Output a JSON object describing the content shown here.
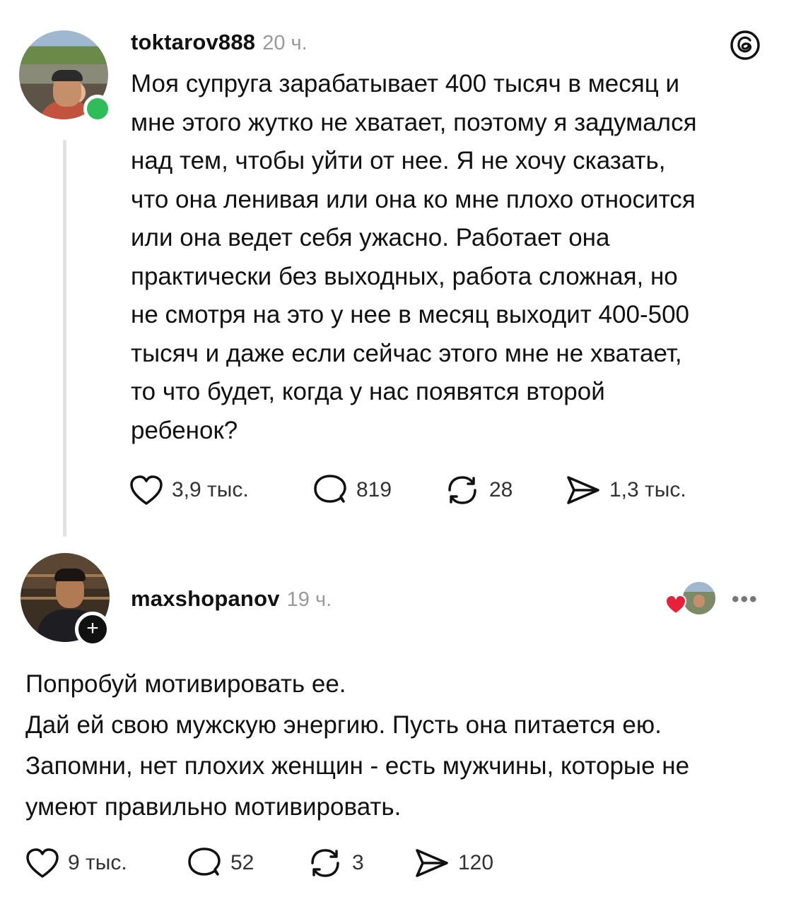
{
  "post": {
    "username": "toktarov888",
    "time": "20 ч.",
    "lines": [
      "Моя супруга зарабатывает 400 тысяч в месяц и",
      "мне этого жутко не хватает, поэтому я задумался",
      "над тем, чтобы уйти от нее. Я не хочу сказать,",
      "что она ленивая или она ко мне плохо относится",
      "или она ведет себя ужасно. Работает она",
      "практически без выходных, работа сложная, но",
      "не смотря на это у нее в месяц выходит 400-500",
      "тысяч и даже если сейчас этого мне не хватает,",
      "то что будет, когда у нас появятся второй",
      "ребенок?"
    ],
    "likes": "3,9 тыс.",
    "comments": "819",
    "reposts": "28",
    "shares": "1,3 тыс.",
    "online_color": "#2ebd59"
  },
  "reply": {
    "username": "maxshopanov",
    "time": "19 ч.",
    "lines": [
      "Попробуй мотивировать ее.",
      "Дай ей свою мужскую энергию. Пусть она питается ею.",
      "Запомни, нет плохих женщин - есть мужчины, которые не",
      "умеют правильно мотивировать."
    ],
    "likes": "9 тыс.",
    "comments": "52",
    "reposts": "3",
    "shares": "120",
    "follow_label": "+",
    "liked_by_author_heart_color": "#e8213a"
  },
  "icons": {
    "app_logo": "threads-logo-icon",
    "like": "heart-icon",
    "comment": "comment-bubble-icon",
    "repost": "repost-icon",
    "share": "send-icon",
    "more": "more-dots-icon"
  }
}
